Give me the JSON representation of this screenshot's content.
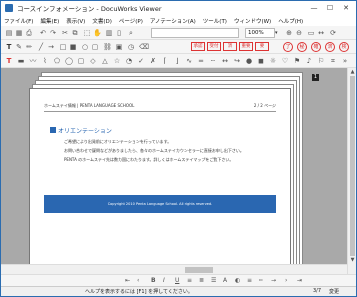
{
  "window": {
    "title": "コースインフォメーション - DocuWorks Viewer",
    "minimize": "—",
    "maximize": "☐",
    "close": "✕"
  },
  "menu": [
    "ファイル(F)",
    "編集(E)",
    "表示(V)",
    "文書(D)",
    "ページ(P)",
    "アノテーション(A)",
    "ツール(T)",
    "ウィンドウ(W)",
    "ヘルプ(H)"
  ],
  "toolbar": {
    "zoom_value": "100%",
    "zoom_dropdown": "▾",
    "search_placeholder": ""
  },
  "stamps": [
    "承認",
    "受付",
    "済",
    "重要",
    "要",
    "了",
    "秘",
    "確",
    "済",
    "検"
  ],
  "page": {
    "header_left": "ホームステイ情報 | PENTA LANGUAGE SCHOOL",
    "header_right": "2 / 2 ページ",
    "section_title": "オリエンテーション",
    "lines": [
      "ご希望により出発前にオリエンテーションを行っています。",
      "お問い合わせで疑問などがありましたら、各々のホームステイカウンセラーに直接お申し出下さい。",
      "PENTA のホームステイ先は数カ国にわたります。詳しくはホームステイマップをご覧下さい。"
    ],
    "footer": "Copyright 2010 Penta Language School. All rights reserved.",
    "badge": "1"
  },
  "status": {
    "help_text": "ヘルプを表示するには [F1] を押してください。",
    "page_indicator": "3/7",
    "modified": "変更"
  },
  "colors": {
    "accent": "#2a67b1",
    "window_border": "#2b6cb0",
    "stamp_red": "#d33333"
  }
}
